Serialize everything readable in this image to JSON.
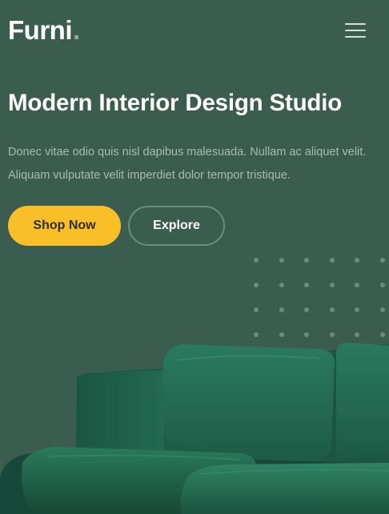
{
  "header": {
    "brand": "Furni",
    "brand_dot": ".",
    "menu_icon": "hamburger-menu-icon"
  },
  "hero": {
    "title": "Modern Interior Design Studio",
    "description": "Donec vitae odio quis nisl dapibus malesuada. Nullam ac aliquet velit. Aliquam vulputate velit imperdiet dolor tempor tristique.",
    "primary_button": "Shop Now",
    "secondary_button": "Explore",
    "image": "green-velvet-sofa"
  },
  "colors": {
    "background": "#3b5d50",
    "accent": "#f9bf29",
    "text": "#ffffff",
    "muted_text": "#a9bab3"
  }
}
